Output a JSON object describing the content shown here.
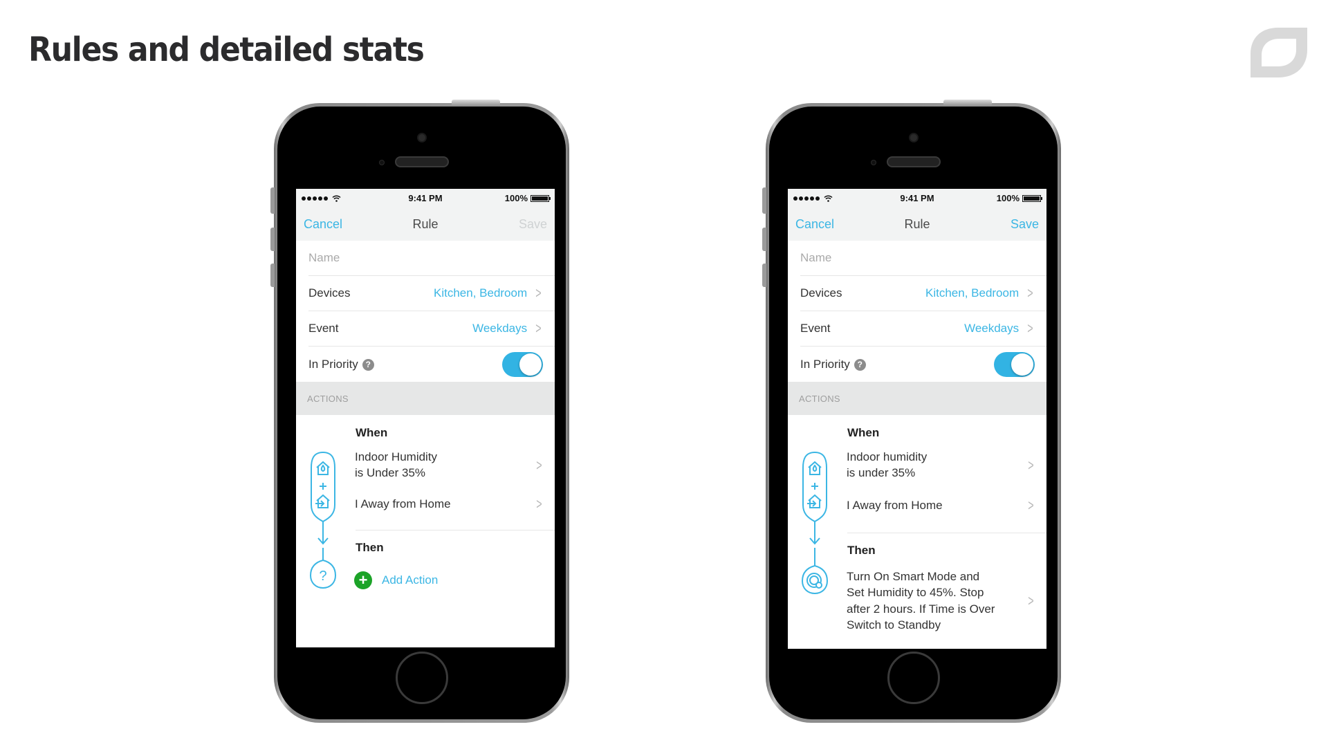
{
  "slide": {
    "title": "Rules and detailed stats",
    "logo_icon": "leaf-logo-icon"
  },
  "colors": {
    "accent": "#3bb6e4",
    "toggle_on": "#32b3e3",
    "add_green": "#1ca328",
    "disabled": "#cfd2d3",
    "section_bg": "#e6e7e7"
  },
  "phones": [
    {
      "status": {
        "signal_icon": "signal-dots-icon",
        "wifi_icon": "wifi-icon",
        "time": "9:41 PM",
        "battery": "100%",
        "battery_icon": "battery-icon"
      },
      "nav": {
        "cancel": "Cancel",
        "title": "Rule",
        "save": "Save",
        "save_enabled": false
      },
      "form": {
        "name_placeholder": "Name",
        "devices_label": "Devices",
        "devices_value": "Kitchen, Bedroom",
        "event_label": "Event",
        "event_value": "Weekdays",
        "priority_label": "In Priority",
        "priority_help": "?",
        "priority_on": true
      },
      "actions": {
        "section_label": "ACTIONS",
        "when_label": "When",
        "conditions": [
          {
            "line1": "Indoor Humidity",
            "line2": "is Under 35%"
          },
          {
            "line1": "I Away from Home",
            "line2": ""
          }
        ],
        "then_label": "Then",
        "add_action": "Add Action",
        "add_icon": "+",
        "pending_icon": "?"
      }
    },
    {
      "status": {
        "signal_icon": "signal-dots-icon",
        "wifi_icon": "wifi-icon",
        "time": "9:41 PM",
        "battery": "100%",
        "battery_icon": "battery-icon"
      },
      "nav": {
        "cancel": "Cancel",
        "title": "Rule",
        "save": "Save",
        "save_enabled": true
      },
      "form": {
        "name_placeholder": "Name",
        "devices_label": "Devices",
        "devices_value": "Kitchen, Bedroom",
        "event_label": "Event",
        "event_value": "Weekdays",
        "priority_label": "In Priority",
        "priority_help": "?",
        "priority_on": true
      },
      "actions": {
        "section_label": "ACTIONS",
        "when_label": "When",
        "conditions": [
          {
            "line1": "Indoor humidity",
            "line2": "is under 35%"
          },
          {
            "line1": "I Away from Home",
            "line2": ""
          }
        ],
        "then_label": "Then",
        "then_action": [
          "Turn On Smart Mode and",
          "Set Humidity to 45%. Stop",
          "after 2 hours.  If Time is Over",
          "Switch to Standby"
        ]
      }
    }
  ]
}
